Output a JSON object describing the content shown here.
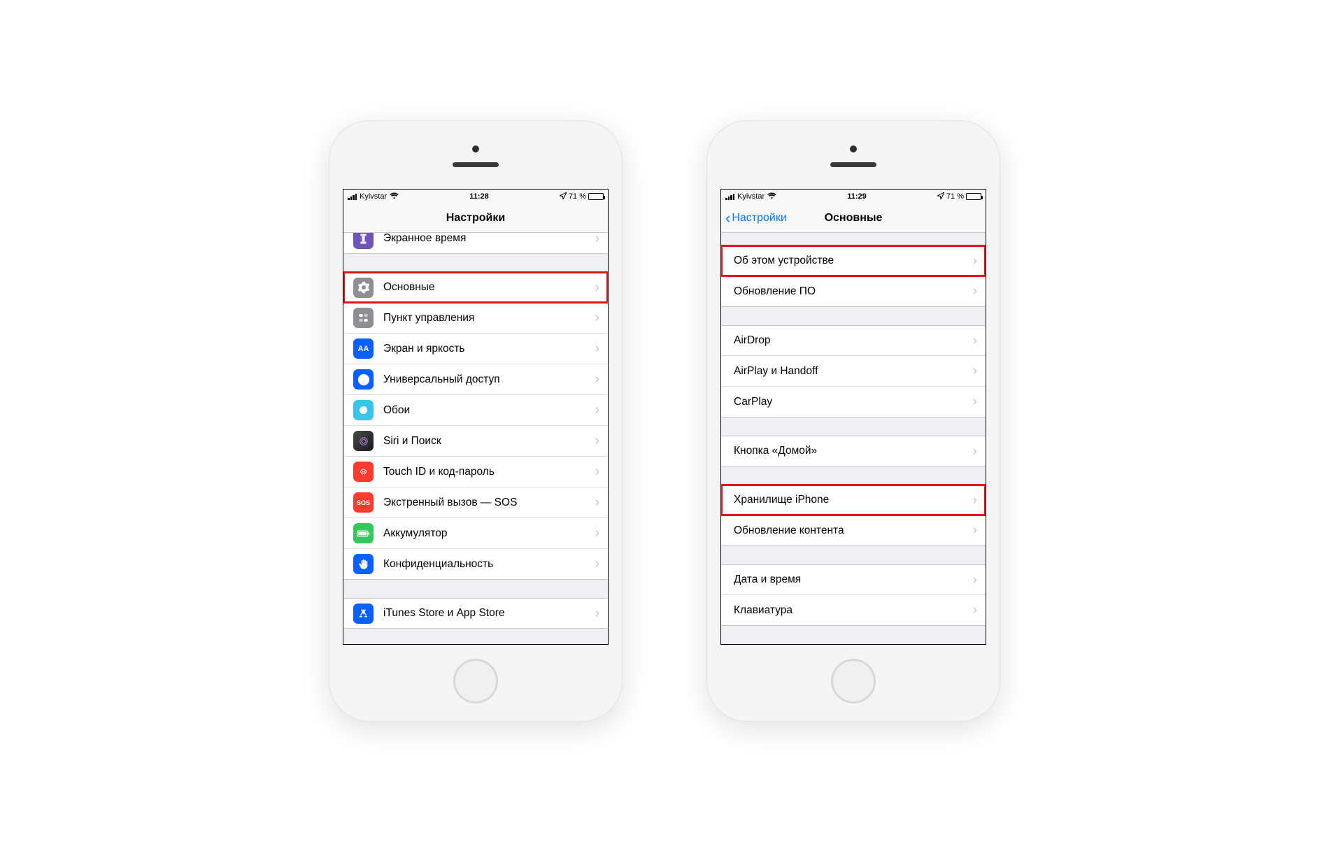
{
  "left_phone": {
    "status": {
      "carrier": "Kyivstar",
      "time": "11:28",
      "battery": "71 %"
    },
    "nav": {
      "title": "Настройки"
    },
    "rows": {
      "screentime": "Экранное время",
      "general": "Основные",
      "control": "Пункт управления",
      "display": "Экран и яркость",
      "accessibility": "Универсальный доступ",
      "wallpaper": "Обои",
      "siri": "Siri и Поиск",
      "touchid": "Touch ID и код-пароль",
      "sos": "Экстренный вызов — SOS",
      "battery": "Аккумулятор",
      "privacy": "Конфиденциальность",
      "itunes": "iTunes Store и App Store"
    },
    "sos_icon_text": "SOS"
  },
  "right_phone": {
    "status": {
      "carrier": "Kyivstar",
      "time": "11:29",
      "battery": "71 %"
    },
    "nav": {
      "back": "Настройки",
      "title": "Основные"
    },
    "rows": {
      "about": "Об этом устройстве",
      "software_update": "Обновление ПО",
      "airdrop": "AirDrop",
      "airplay": "AirPlay и Handoff",
      "carplay": "CarPlay",
      "home_button": "Кнопка «Домой»",
      "storage": "Хранилище iPhone",
      "background_refresh": "Обновление контента",
      "datetime": "Дата и время",
      "keyboard": "Клавиатура"
    }
  }
}
